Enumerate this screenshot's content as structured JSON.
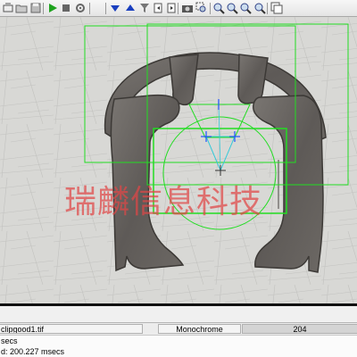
{
  "toolbar": {
    "buttons": [
      {
        "icon": "tool-icon"
      },
      {
        "icon": "open-folder-icon"
      },
      {
        "icon": "save-icon"
      },
      {
        "icon": "run-icon",
        "color": "#1fa31f"
      },
      {
        "icon": "stop-icon"
      },
      {
        "icon": "settings-icon"
      },
      {
        "icon": "arrow-down-icon",
        "color": "#1a3fbf"
      },
      {
        "icon": "arrow-up-icon",
        "color": "#1a3fbf"
      },
      {
        "icon": "filter-icon"
      },
      {
        "icon": "page-left-icon"
      },
      {
        "icon": "page-right-icon"
      },
      {
        "icon": "camera-icon"
      },
      {
        "icon": "zoom-select-icon"
      },
      {
        "icon": "zoom-in-icon"
      },
      {
        "icon": "zoom-out-icon"
      },
      {
        "icon": "zoom-fit-icon"
      },
      {
        "icon": "zoom-actual-icon"
      },
      {
        "icon": "copy-window-icon"
      }
    ]
  },
  "image": {
    "watermark": "瑞麟信息科技",
    "overlay_color": "#22dd22",
    "marker_color": "#2255ff",
    "triangle_color": "#33c8d8"
  },
  "status": {
    "filename": "clipgood1.tif",
    "mode": "Monochrome",
    "pixel_value": "204"
  },
  "log": {
    "line1": "secs",
    "line2": "d: 200.227 msecs"
  }
}
